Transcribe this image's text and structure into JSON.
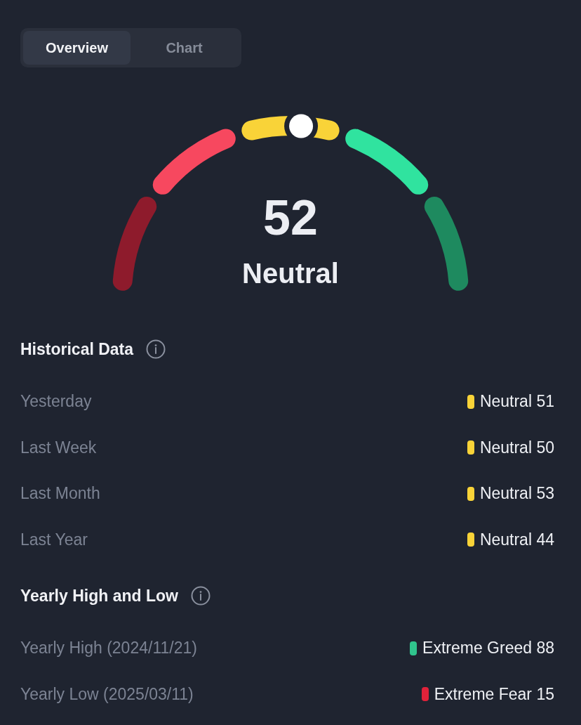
{
  "tabs": [
    {
      "label": "Overview",
      "selected": true
    },
    {
      "label": "Chart",
      "selected": false
    }
  ],
  "gauge": {
    "level": 0.52,
    "value": "52",
    "label": "Neutral",
    "segments": [
      {
        "color": "#8e1b2c"
      },
      {
        "color": "#f7485f"
      },
      {
        "color": "#f9d338"
      },
      {
        "color": "#30e39f"
      },
      {
        "color": "#1e8a5f"
      }
    ]
  },
  "sections": [
    {
      "title": "Historical Data",
      "rows": [
        {
          "label": "Yesterday",
          "reading": "Neutral 51",
          "color": "#f9d338"
        },
        {
          "label": "Last Week",
          "reading": "Neutral 50",
          "color": "#f9d338"
        },
        {
          "label": "Last Month",
          "reading": "Neutral 53",
          "color": "#f9d338"
        },
        {
          "label": "Last Year",
          "reading": "Neutral 44",
          "color": "#f9d338"
        }
      ]
    },
    {
      "title": "Yearly High and Low",
      "rows": [
        {
          "label": "Yearly High (2024/11/21)",
          "reading": "Extreme Greed 88",
          "color": "#30c48d"
        },
        {
          "label": "Yearly Low (2025/03/11)",
          "reading": "Extreme Fear 15",
          "color": "#e0223a"
        }
      ]
    }
  ]
}
